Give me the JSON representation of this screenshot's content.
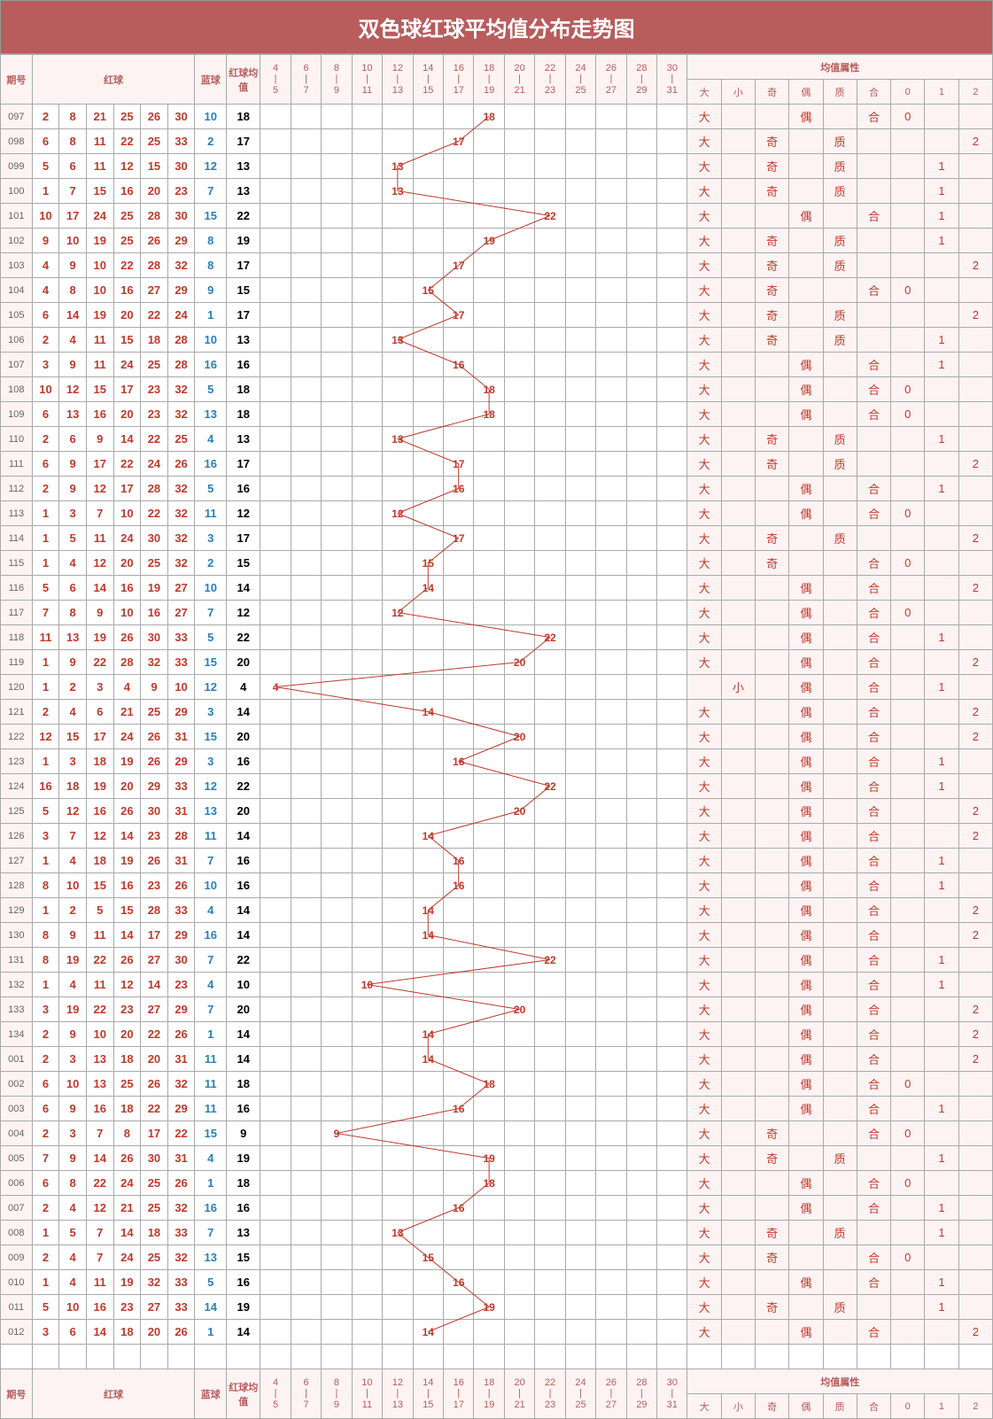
{
  "title": "双色球红球平均值分布走势图",
  "headers": {
    "period": "期号",
    "red": "红球",
    "blue": "蓝球",
    "avg": "红球均值",
    "attr_group": "均值属性",
    "trend_ranges": [
      "4|5",
      "6|7",
      "8|9",
      "10|11",
      "12|13",
      "14|15",
      "16|17",
      "18|19",
      "20|21",
      "22|23",
      "24|25",
      "26|27",
      "28|29",
      "30|31"
    ],
    "attrs": [
      "大",
      "小",
      "奇",
      "偶",
      "质",
      "合",
      "0",
      "1",
      "2"
    ]
  },
  "trend_mids": [
    4.5,
    6.5,
    8.5,
    10.5,
    12.5,
    14.5,
    16.5,
    18.5,
    20.5,
    22.5,
    24.5,
    26.5,
    28.5,
    30.5
  ],
  "chart_data": {
    "type": "line",
    "title": "双色球红球平均值分布走势图",
    "xlabel": "期号",
    "ylabel": "红球均值",
    "ylim": [
      4,
      31
    ],
    "series": [
      {
        "name": "红球均值",
        "values": [
          18,
          17,
          13,
          13,
          22,
          19,
          17,
          15,
          17,
          13,
          16,
          18,
          18,
          13,
          17,
          16,
          12,
          17,
          15,
          14,
          12,
          22,
          20,
          4,
          14,
          20,
          16,
          22,
          20,
          14,
          16,
          16,
          14,
          14,
          22,
          10,
          20,
          14,
          14,
          18,
          16,
          9,
          19,
          18,
          16,
          13,
          15,
          16,
          19,
          14
        ]
      }
    ],
    "categories": [
      "097",
      "098",
      "099",
      "100",
      "101",
      "102",
      "103",
      "104",
      "105",
      "106",
      "107",
      "108",
      "109",
      "110",
      "111",
      "112",
      "113",
      "114",
      "115",
      "116",
      "117",
      "118",
      "119",
      "120",
      "121",
      "122",
      "123",
      "124",
      "125",
      "126",
      "127",
      "128",
      "129",
      "130",
      "131",
      "132",
      "133",
      "134",
      "001",
      "002",
      "003",
      "004",
      "005",
      "006",
      "007",
      "008",
      "009",
      "010",
      "011",
      "012"
    ]
  },
  "rows": [
    {
      "p": "097",
      "r": [
        2,
        8,
        21,
        25,
        26,
        30
      ],
      "b": 10,
      "a": 18,
      "at": {
        "大": "大",
        "偶": "偶",
        "合": "合",
        "0": "0"
      }
    },
    {
      "p": "098",
      "r": [
        6,
        8,
        11,
        22,
        25,
        33
      ],
      "b": 2,
      "a": 17,
      "at": {
        "大": "大",
        "奇": "奇",
        "质": "质",
        "2": "2"
      }
    },
    {
      "p": "099",
      "r": [
        5,
        6,
        11,
        12,
        15,
        30
      ],
      "b": 12,
      "a": 13,
      "at": {
        "大": "大",
        "奇": "奇",
        "质": "质",
        "1": "1"
      }
    },
    {
      "p": "100",
      "r": [
        1,
        7,
        15,
        16,
        20,
        23
      ],
      "b": 7,
      "a": 13,
      "at": {
        "大": "大",
        "奇": "奇",
        "质": "质",
        "1": "1"
      }
    },
    {
      "p": "101",
      "r": [
        10,
        17,
        24,
        25,
        28,
        30
      ],
      "b": 15,
      "a": 22,
      "at": {
        "大": "大",
        "偶": "偶",
        "合": "合",
        "1": "1"
      }
    },
    {
      "p": "102",
      "r": [
        9,
        10,
        19,
        25,
        26,
        29
      ],
      "b": 8,
      "a": 19,
      "at": {
        "大": "大",
        "奇": "奇",
        "质": "质",
        "1": "1"
      }
    },
    {
      "p": "103",
      "r": [
        4,
        9,
        10,
        22,
        28,
        32
      ],
      "b": 8,
      "a": 17,
      "at": {
        "大": "大",
        "奇": "奇",
        "质": "质",
        "2": "2"
      }
    },
    {
      "p": "104",
      "r": [
        4,
        8,
        10,
        16,
        27,
        29
      ],
      "b": 9,
      "a": 15,
      "at": {
        "大": "大",
        "奇": "奇",
        "合": "合",
        "0": "0"
      }
    },
    {
      "p": "105",
      "r": [
        6,
        14,
        19,
        20,
        22,
        24
      ],
      "b": 1,
      "a": 17,
      "at": {
        "大": "大",
        "奇": "奇",
        "质": "质",
        "2": "2"
      }
    },
    {
      "p": "106",
      "r": [
        2,
        4,
        11,
        15,
        18,
        28
      ],
      "b": 10,
      "a": 13,
      "at": {
        "大": "大",
        "奇": "奇",
        "质": "质",
        "1": "1"
      }
    },
    {
      "p": "107",
      "r": [
        3,
        9,
        11,
        24,
        25,
        28
      ],
      "b": 16,
      "a": 16,
      "at": {
        "大": "大",
        "偶": "偶",
        "合": "合",
        "1": "1"
      }
    },
    {
      "p": "108",
      "r": [
        10,
        12,
        15,
        17,
        23,
        32
      ],
      "b": 5,
      "a": 18,
      "at": {
        "大": "大",
        "偶": "偶",
        "合": "合",
        "0": "0"
      }
    },
    {
      "p": "109",
      "r": [
        6,
        13,
        16,
        20,
        23,
        32
      ],
      "b": 13,
      "a": 18,
      "at": {
        "大": "大",
        "偶": "偶",
        "合": "合",
        "0": "0"
      }
    },
    {
      "p": "110",
      "r": [
        2,
        6,
        9,
        14,
        22,
        25
      ],
      "b": 4,
      "a": 13,
      "at": {
        "大": "大",
        "奇": "奇",
        "质": "质",
        "1": "1"
      }
    },
    {
      "p": "111",
      "r": [
        6,
        9,
        17,
        22,
        24,
        26
      ],
      "b": 16,
      "a": 17,
      "at": {
        "大": "大",
        "奇": "奇",
        "质": "质",
        "2": "2"
      }
    },
    {
      "p": "112",
      "r": [
        2,
        9,
        12,
        17,
        28,
        32
      ],
      "b": 5,
      "a": 16,
      "at": {
        "大": "大",
        "偶": "偶",
        "合": "合",
        "1": "1"
      }
    },
    {
      "p": "113",
      "r": [
        1,
        3,
        7,
        10,
        22,
        32
      ],
      "b": 11,
      "a": 12,
      "at": {
        "大": "大",
        "偶": "偶",
        "合": "合",
        "0": "0"
      }
    },
    {
      "p": "114",
      "r": [
        1,
        5,
        11,
        24,
        30,
        32
      ],
      "b": 3,
      "a": 17,
      "at": {
        "大": "大",
        "奇": "奇",
        "质": "质",
        "2": "2"
      }
    },
    {
      "p": "115",
      "r": [
        1,
        4,
        12,
        20,
        25,
        32
      ],
      "b": 2,
      "a": 15,
      "at": {
        "大": "大",
        "奇": "奇",
        "合": "合",
        "0": "0"
      }
    },
    {
      "p": "116",
      "r": [
        5,
        6,
        14,
        16,
        19,
        27
      ],
      "b": 10,
      "a": 14,
      "at": {
        "大": "大",
        "偶": "偶",
        "合": "合",
        "2": "2"
      }
    },
    {
      "p": "117",
      "r": [
        7,
        8,
        9,
        10,
        16,
        27
      ],
      "b": 7,
      "a": 12,
      "at": {
        "大": "大",
        "偶": "偶",
        "合": "合",
        "0": "0"
      }
    },
    {
      "p": "118",
      "r": [
        11,
        13,
        19,
        26,
        30,
        33
      ],
      "b": 5,
      "a": 22,
      "at": {
        "大": "大",
        "偶": "偶",
        "合": "合",
        "1": "1"
      }
    },
    {
      "p": "119",
      "r": [
        1,
        9,
        22,
        28,
        32,
        33
      ],
      "b": 15,
      "a": 20,
      "at": {
        "大": "大",
        "偶": "偶",
        "合": "合",
        "2": "2"
      }
    },
    {
      "p": "120",
      "r": [
        1,
        2,
        3,
        4,
        9,
        10
      ],
      "b": 12,
      "a": 4,
      "at": {
        "小": "小",
        "偶": "偶",
        "合": "合",
        "1": "1"
      }
    },
    {
      "p": "121",
      "r": [
        2,
        4,
        6,
        21,
        25,
        29
      ],
      "b": 3,
      "a": 14,
      "at": {
        "大": "大",
        "偶": "偶",
        "合": "合",
        "2": "2"
      }
    },
    {
      "p": "122",
      "r": [
        12,
        15,
        17,
        24,
        26,
        31
      ],
      "b": 15,
      "a": 20,
      "at": {
        "大": "大",
        "偶": "偶",
        "合": "合",
        "2": "2"
      }
    },
    {
      "p": "123",
      "r": [
        1,
        3,
        18,
        19,
        26,
        29
      ],
      "b": 3,
      "a": 16,
      "at": {
        "大": "大",
        "偶": "偶",
        "合": "合",
        "1": "1"
      }
    },
    {
      "p": "124",
      "r": [
        16,
        18,
        19,
        20,
        29,
        33
      ],
      "b": 12,
      "a": 22,
      "at": {
        "大": "大",
        "偶": "偶",
        "合": "合",
        "1": "1"
      }
    },
    {
      "p": "125",
      "r": [
        5,
        12,
        16,
        26,
        30,
        31
      ],
      "b": 13,
      "a": 20,
      "at": {
        "大": "大",
        "偶": "偶",
        "合": "合",
        "2": "2"
      }
    },
    {
      "p": "126",
      "r": [
        3,
        7,
        12,
        14,
        23,
        28
      ],
      "b": 11,
      "a": 14,
      "at": {
        "大": "大",
        "偶": "偶",
        "合": "合",
        "2": "2"
      }
    },
    {
      "p": "127",
      "r": [
        1,
        4,
        18,
        19,
        26,
        31
      ],
      "b": 7,
      "a": 16,
      "at": {
        "大": "大",
        "偶": "偶",
        "合": "合",
        "1": "1"
      }
    },
    {
      "p": "128",
      "r": [
        8,
        10,
        15,
        16,
        23,
        26
      ],
      "b": 10,
      "a": 16,
      "at": {
        "大": "大",
        "偶": "偶",
        "合": "合",
        "1": "1"
      }
    },
    {
      "p": "129",
      "r": [
        1,
        2,
        5,
        15,
        28,
        33
      ],
      "b": 4,
      "a": 14,
      "at": {
        "大": "大",
        "偶": "偶",
        "合": "合",
        "2": "2"
      }
    },
    {
      "p": "130",
      "r": [
        8,
        9,
        11,
        14,
        17,
        29
      ],
      "b": 16,
      "a": 14,
      "at": {
        "大": "大",
        "偶": "偶",
        "合": "合",
        "2": "2"
      }
    },
    {
      "p": "131",
      "r": [
        8,
        19,
        22,
        26,
        27,
        30
      ],
      "b": 7,
      "a": 22,
      "at": {
        "大": "大",
        "偶": "偶",
        "合": "合",
        "1": "1"
      }
    },
    {
      "p": "132",
      "r": [
        1,
        4,
        11,
        12,
        14,
        23
      ],
      "b": 4,
      "a": 10,
      "at": {
        "大": "大",
        "偶": "偶",
        "合": "合",
        "1": "1"
      }
    },
    {
      "p": "133",
      "r": [
        3,
        19,
        22,
        23,
        27,
        29
      ],
      "b": 7,
      "a": 20,
      "at": {
        "大": "大",
        "偶": "偶",
        "合": "合",
        "2": "2"
      }
    },
    {
      "p": "134",
      "r": [
        2,
        9,
        10,
        20,
        22,
        26
      ],
      "b": 1,
      "a": 14,
      "at": {
        "大": "大",
        "偶": "偶",
        "合": "合",
        "2": "2"
      }
    },
    {
      "p": "001",
      "r": [
        2,
        3,
        13,
        18,
        20,
        31
      ],
      "b": 11,
      "a": 14,
      "at": {
        "大": "大",
        "偶": "偶",
        "合": "合",
        "2": "2"
      }
    },
    {
      "p": "002",
      "r": [
        6,
        10,
        13,
        25,
        26,
        32
      ],
      "b": 11,
      "a": 18,
      "at": {
        "大": "大",
        "偶": "偶",
        "合": "合",
        "0": "0"
      }
    },
    {
      "p": "003",
      "r": [
        6,
        9,
        16,
        18,
        22,
        29
      ],
      "b": 11,
      "a": 16,
      "at": {
        "大": "大",
        "偶": "偶",
        "合": "合",
        "1": "1"
      }
    },
    {
      "p": "004",
      "r": [
        2,
        3,
        7,
        8,
        17,
        22
      ],
      "b": 15,
      "a": 9,
      "at": {
        "大": "大",
        "奇": "奇",
        "合": "合",
        "0": "0"
      }
    },
    {
      "p": "005",
      "r": [
        7,
        9,
        14,
        26,
        30,
        31
      ],
      "b": 4,
      "a": 19,
      "at": {
        "大": "大",
        "奇": "奇",
        "质": "质",
        "1": "1"
      }
    },
    {
      "p": "006",
      "r": [
        6,
        8,
        22,
        24,
        25,
        26
      ],
      "b": 1,
      "a": 18,
      "at": {
        "大": "大",
        "偶": "偶",
        "合": "合",
        "0": "0"
      }
    },
    {
      "p": "007",
      "r": [
        2,
        4,
        12,
        21,
        25,
        32
      ],
      "b": 16,
      "a": 16,
      "at": {
        "大": "大",
        "偶": "偶",
        "合": "合",
        "1": "1"
      }
    },
    {
      "p": "008",
      "r": [
        1,
        5,
        7,
        14,
        18,
        33
      ],
      "b": 7,
      "a": 13,
      "at": {
        "大": "大",
        "奇": "奇",
        "质": "质",
        "1": "1"
      }
    },
    {
      "p": "009",
      "r": [
        2,
        4,
        7,
        24,
        25,
        32
      ],
      "b": 13,
      "a": 15,
      "at": {
        "大": "大",
        "奇": "奇",
        "合": "合",
        "0": "0"
      }
    },
    {
      "p": "010",
      "r": [
        1,
        4,
        11,
        19,
        32,
        33
      ],
      "b": 5,
      "a": 16,
      "at": {
        "大": "大",
        "偶": "偶",
        "合": "合",
        "1": "1"
      }
    },
    {
      "p": "011",
      "r": [
        5,
        10,
        16,
        23,
        27,
        33
      ],
      "b": 14,
      "a": 19,
      "at": {
        "大": "大",
        "奇": "奇",
        "质": "质",
        "1": "1"
      }
    },
    {
      "p": "012",
      "r": [
        3,
        6,
        14,
        18,
        20,
        26
      ],
      "b": 1,
      "a": 14,
      "at": {
        "大": "大",
        "偶": "偶",
        "合": "合",
        "2": "2"
      }
    }
  ]
}
